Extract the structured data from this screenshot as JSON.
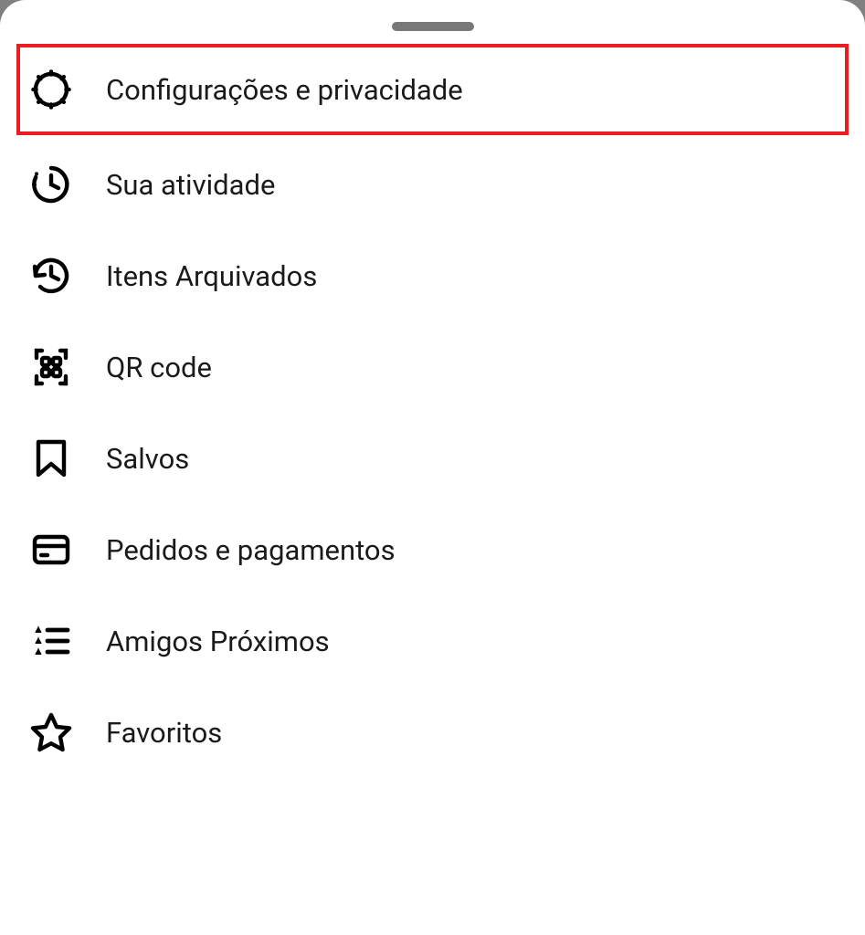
{
  "menu": {
    "items": [
      {
        "label": "Configurações e privacidade"
      },
      {
        "label": "Sua atividade"
      },
      {
        "label": "Itens Arquivados"
      },
      {
        "label": "QR code"
      },
      {
        "label": "Salvos"
      },
      {
        "label": "Pedidos e pagamentos"
      },
      {
        "label": "Amigos Próximos"
      },
      {
        "label": "Favoritos"
      }
    ]
  }
}
